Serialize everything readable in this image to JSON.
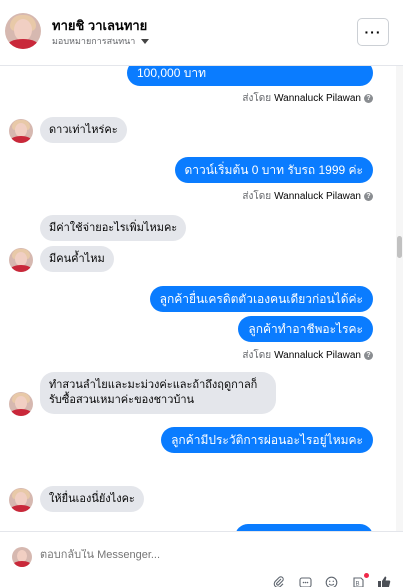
{
  "header": {
    "name": "ทายชิ วาเลนทาย",
    "subtitle": "มอบหมายการสนทนา",
    "more_label": "···",
    "avatar_icon": "profile-photo"
  },
  "messages": {
    "m1_out": "100,000 บาท",
    "m1_sentby_prefix": "ส่งโดย",
    "m1_sentby_name": "Wannaluck Pilawan",
    "m2_in": "ดาวเท่าไหร่คะ",
    "m3_out": "ดาวน์เริ่มต้น 0 บาท รับรถ 1999 ค่ะ",
    "m3_sentby_prefix": "ส่งโดย",
    "m3_sentby_name": "Wannaluck Pilawan",
    "m4_in": "มีค่าใช้จ่ายอะไรเพิ่มไหมคะ",
    "m5_in": "มีคนค้ำไหม",
    "m6_out": "ลูกค้ายื่นเครดิตตัวเองคนเดียวก่อนได้ค่ะ",
    "m7_out": "ลูกค้าทำอาชีพอะไรคะ",
    "m7_sentby_prefix": "ส่งโดย",
    "m7_sentby_name": "Wannaluck Pilawan",
    "m8_in": "ทำสวนลำไยและมะม่วงค่ะและถ้าถึงฤดูกาลก็รับซื้อสวนเหมาค่ะของชาวบ้าน",
    "m9_out": "ลูกค้ามีประวัติการผ่อนอะไรอยู่ไหมคะ",
    "m10_in": "ให้ยื่นเองนี่ยังไงคะ"
  },
  "composer": {
    "placeholder": "ตอบกลับใน Messenger...",
    "tools": [
      "attachment-icon",
      "gif-icon",
      "emoji-icon",
      "sticker-icon",
      "like-icon"
    ]
  },
  "colors": {
    "outgoing_bubble": "#0a7cff",
    "incoming_bubble": "#e4e6eb",
    "notification_dot": "#f02849"
  }
}
